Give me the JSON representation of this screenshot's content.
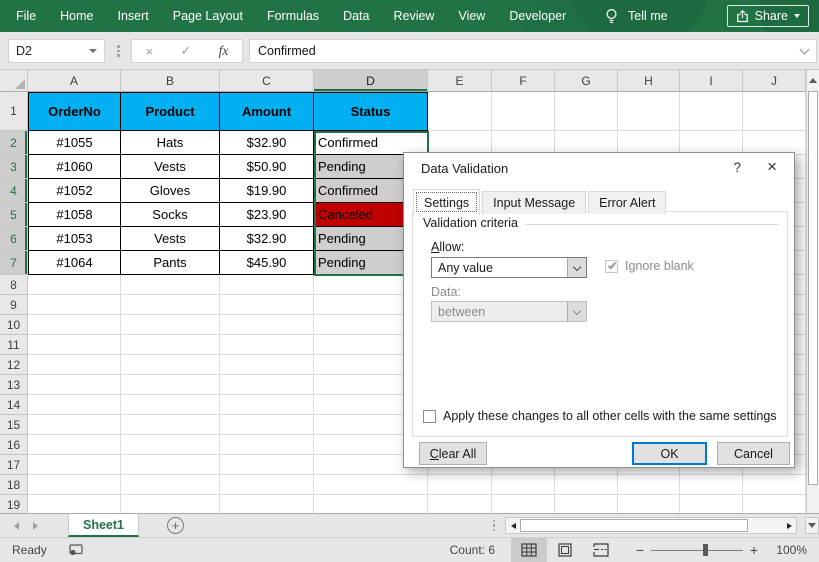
{
  "ribbon": {
    "tabs": [
      "File",
      "Home",
      "Insert",
      "Page Layout",
      "Formulas",
      "Data",
      "Review",
      "View",
      "Developer"
    ],
    "tell_me": "Tell me",
    "share_label": "Share"
  },
  "formula_bar": {
    "name_box": "D2",
    "cancel_icon": "×",
    "enter_icon": "✓",
    "fx_icon": "fx",
    "value": "Confirmed"
  },
  "sheet": {
    "columns": [
      "A",
      "B",
      "C",
      "D",
      "E",
      "F",
      "G",
      "H",
      "I",
      "J"
    ],
    "row_count": 19,
    "selection": {
      "active_cell": "D2",
      "column": "D",
      "rows": [
        2,
        3,
        4,
        5,
        6,
        7
      ]
    },
    "table": {
      "headers": [
        "OrderNo",
        "Product",
        "Amount",
        "Status"
      ],
      "rows": [
        [
          "#1055",
          "Hats",
          "$32.90",
          "Confirmed"
        ],
        [
          "#1060",
          "Vests",
          "$50.90",
          "Pending"
        ],
        [
          "#1052",
          "Gloves",
          "$19.90",
          "Confirmed"
        ],
        [
          "#1058",
          "Socks",
          "$23.90",
          "Canceled"
        ],
        [
          "#1053",
          "Vests",
          "$32.90",
          "Pending"
        ],
        [
          "#1064",
          "Pants",
          "$45.90",
          "Pending"
        ]
      ]
    },
    "colors": {
      "header_fill": "#00B0F0",
      "canceled_fill": "#C00000",
      "selection_tint": "#CFCDCE",
      "selection_border": "#217346",
      "ribbon_green": "#217346"
    },
    "status_fills": {
      "Canceled": "#C00000"
    }
  },
  "dialog": {
    "title": "Data Validation",
    "help_icon": "?",
    "close_icon": "×",
    "tabs": [
      "Settings",
      "Input Message",
      "Error Alert"
    ],
    "active_tab": "Settings",
    "group_label": "Validation criteria",
    "allow_label": "Allow:",
    "allow_value": "Any value",
    "ignore_blank_label": "Ignore blank",
    "data_label": "Data:",
    "data_value": "between",
    "apply_label": "Apply these changes to all other cells with the same settings",
    "buttons": {
      "clear_all": "Clear All",
      "ok": "OK",
      "cancel": "Cancel"
    }
  },
  "tab_bar": {
    "sheet_name": "Sheet1",
    "new_sheet_icon": "+"
  },
  "status_bar": {
    "ready": "Ready",
    "count": "Count: 6",
    "zoom_out": "−",
    "zoom_in": "+",
    "zoom_level": "100%"
  }
}
